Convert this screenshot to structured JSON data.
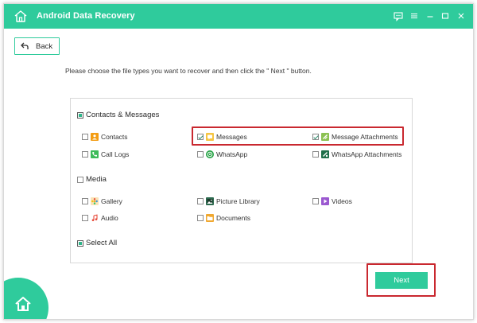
{
  "window": {
    "title": "Android Data Recovery",
    "accent_color": "#2fcb9c",
    "highlight_color": "#c9282f",
    "controls": [
      "feedback-icon",
      "menu-icon",
      "minimize-icon",
      "maximize-icon",
      "close-icon"
    ]
  },
  "nav": {
    "back_label": "Back",
    "back_icon": "back-arrow-icon"
  },
  "instruction": "Please choose the file types you want to recover and then click the \" Next \" button.",
  "sections": {
    "contacts_messages": {
      "label": "Contacts & Messages",
      "state": "partial",
      "items": [
        {
          "label": "Contacts",
          "checked": false,
          "icon": "contacts-icon",
          "color": "#f39c12"
        },
        {
          "label": "Messages",
          "checked": true,
          "icon": "messages-icon",
          "color": "#f5c542"
        },
        {
          "label": "Message Attachments",
          "checked": true,
          "icon": "attachment-icon",
          "color": "#8cc152"
        },
        {
          "label": "Call Logs",
          "checked": false,
          "icon": "call-logs-icon",
          "color": "#3dbb5a"
        },
        {
          "label": "WhatsApp",
          "checked": false,
          "icon": "whatsapp-icon",
          "color": "#25a244"
        },
        {
          "label": "WhatsApp Attachments",
          "checked": false,
          "icon": "whatsapp-attachment-icon",
          "color": "#1f6f4a"
        }
      ]
    },
    "media": {
      "label": "Media",
      "state": "unchecked",
      "items": [
        {
          "label": "Gallery",
          "checked": false,
          "icon": "gallery-icon",
          "color": "#f0a830"
        },
        {
          "label": "Picture Library",
          "checked": false,
          "icon": "picture-library-icon",
          "color": "#2d6a4f"
        },
        {
          "label": "Videos",
          "checked": false,
          "icon": "videos-icon",
          "color": "#9b59d0"
        },
        {
          "label": "Audio",
          "checked": false,
          "icon": "audio-icon",
          "color": "#e74c3c"
        },
        {
          "label": "Documents",
          "checked": false,
          "icon": "documents-icon",
          "color": "#f0a830"
        }
      ]
    }
  },
  "select_all": {
    "label": "Select All",
    "state": "partial"
  },
  "next_label": "Next"
}
